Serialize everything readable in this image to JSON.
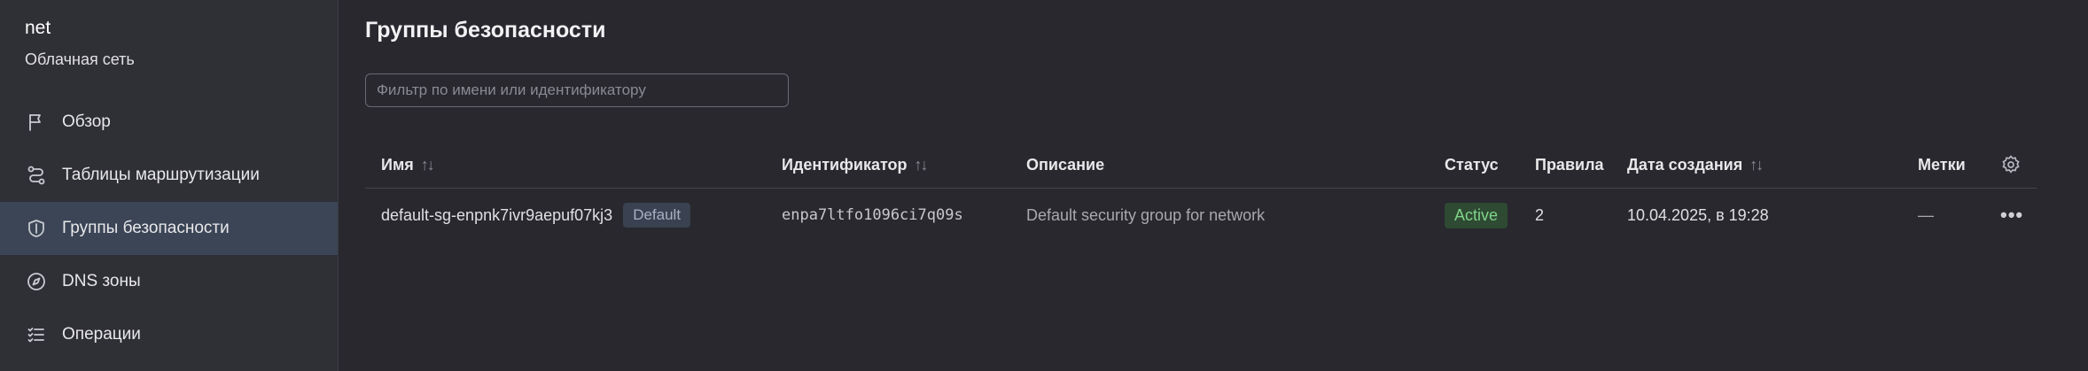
{
  "sidebar": {
    "title": "net",
    "subtitle": "Облачная сеть",
    "items": [
      {
        "label": "Обзор",
        "icon": "flag-icon"
      },
      {
        "label": "Таблицы маршрутизации",
        "icon": "route-icon"
      },
      {
        "label": "Группы безопасности",
        "icon": "shield-icon",
        "active": true
      },
      {
        "label": "DNS зоны",
        "icon": "compass-icon"
      },
      {
        "label": "Операции",
        "icon": "list-icon"
      }
    ]
  },
  "main": {
    "title": "Группы безопасности",
    "filter": {
      "placeholder": "Фильтр по имени или идентификатору",
      "value": ""
    },
    "table": {
      "columns": {
        "name": "Имя",
        "id": "Идентификатор",
        "description": "Описание",
        "status": "Статус",
        "rules": "Правила",
        "created": "Дата создания",
        "tags": "Метки"
      },
      "sort_glyph": "↑↓",
      "rows": [
        {
          "name": "default-sg-enpnk7ivr9aepuf07kj3",
          "badge": "Default",
          "id": "enpa7ltfo1096ci7q09s",
          "description": "Default security group for network",
          "status": "Active",
          "rules": "2",
          "created": "10.04.2025, в 19:28",
          "tags": "—",
          "actions": "•••"
        }
      ]
    }
  },
  "colors": {
    "background": "#28282e",
    "sidebar": "#2f2f36",
    "active_item": "#3b4556",
    "status_active": "#7fd38a"
  }
}
